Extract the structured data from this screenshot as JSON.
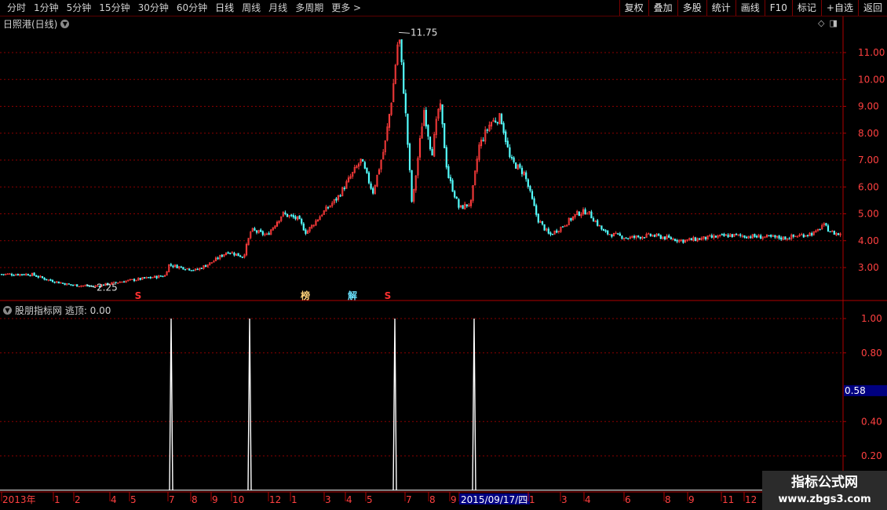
{
  "toolbar": {
    "left_items": [
      "分时",
      "1分钟",
      "5分钟",
      "15分钟",
      "30分钟",
      "60分钟",
      "日线",
      "周线",
      "月线",
      "多周期",
      "更多 >"
    ],
    "right_items": [
      "复权",
      "叠加",
      "多股",
      "统计",
      "画线",
      "F10",
      "标记",
      "+自选",
      "返回"
    ]
  },
  "main_panel": {
    "title": "日照港(日线)",
    "high_label": "11.75",
    "low_label": "2.25",
    "markers": [
      "S",
      "榜",
      "解",
      "S"
    ]
  },
  "indicator_panel": {
    "title": "股朋指标网 逃顶: 0.00",
    "current_value": "0.58"
  },
  "x_axis": {
    "labels": [
      "2013年",
      "1",
      "2",
      "4",
      "5",
      "7",
      "8",
      "9",
      "10",
      "12",
      "1",
      "3",
      "4",
      "5",
      "7",
      "8",
      "9",
      "2015/09/17/四",
      "1",
      "3",
      "4",
      "6",
      "8",
      "9",
      "11",
      "12"
    ]
  },
  "watermark": {
    "line1": "指标公式网",
    "line2": "www.zbgs3.com"
  },
  "colors": {
    "up": "#ff3b3b",
    "down": "#54ffff",
    "grid": "#8b0000",
    "axis_text": "#ff4040",
    "signal": "#ffffff",
    "highlight_bg": "#000080"
  },
  "chart_data": [
    {
      "type": "candlestick",
      "title": "日照港(日线)",
      "y_ticks": [
        3.0,
        4.0,
        5.0,
        6.0,
        7.0,
        8.0,
        9.0,
        10.0,
        11.0
      ],
      "ylim": [
        2.2,
        12.0
      ],
      "high": 11.75,
      "low": 2.25,
      "price_path": [
        [
          0,
          2.75
        ],
        [
          40,
          2.75
        ],
        [
          60,
          2.55
        ],
        [
          90,
          2.35
        ],
        [
          120,
          2.3
        ],
        [
          160,
          2.5
        ],
        [
          210,
          2.7
        ],
        [
          215,
          3.1
        ],
        [
          250,
          2.9
        ],
        [
          270,
          3.2
        ],
        [
          290,
          3.6
        ],
        [
          310,
          3.4
        ],
        [
          320,
          4.4
        ],
        [
          340,
          4.2
        ],
        [
          360,
          5.0
        ],
        [
          380,
          4.8
        ],
        [
          390,
          4.3
        ],
        [
          410,
          5.0
        ],
        [
          430,
          5.6
        ],
        [
          460,
          7.0
        ],
        [
          475,
          5.8
        ],
        [
          490,
          7.5
        ],
        [
          500,
          9.5
        ],
        [
          508,
          11.75
        ],
        [
          516,
          9.0
        ],
        [
          525,
          5.3
        ],
        [
          540,
          8.9
        ],
        [
          550,
          7.2
        ],
        [
          560,
          9.2
        ],
        [
          570,
          6.5
        ],
        [
          585,
          5.2
        ],
        [
          600,
          5.4
        ],
        [
          610,
          7.5
        ],
        [
          625,
          8.4
        ],
        [
          638,
          8.6
        ],
        [
          650,
          7.0
        ],
        [
          668,
          6.5
        ],
        [
          685,
          4.8
        ],
        [
          700,
          4.2
        ],
        [
          715,
          4.5
        ],
        [
          735,
          5.0
        ],
        [
          748,
          5.1
        ],
        [
          770,
          4.3
        ],
        [
          800,
          4.1
        ],
        [
          830,
          4.2
        ],
        [
          870,
          4.0
        ],
        [
          930,
          4.2
        ],
        [
          1000,
          4.1
        ],
        [
          1040,
          4.3
        ],
        [
          1048,
          4.6
        ],
        [
          1060,
          4.3
        ],
        [
          1075,
          4.2
        ]
      ]
    },
    {
      "type": "line",
      "title": "股朋指标网 逃顶",
      "y_ticks": [
        0.2,
        0.4,
        0.58,
        0.8,
        1.0
      ],
      "ylim": [
        0,
        1.0
      ],
      "value": 0.0,
      "spike_value": 1.0
    }
  ]
}
